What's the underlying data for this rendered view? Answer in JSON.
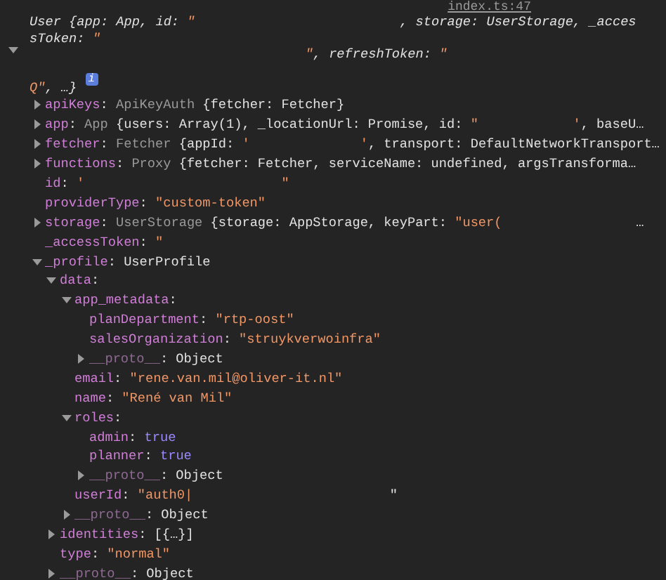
{
  "console": {
    "source_link": "index.ts:47",
    "object": {
      "expanded": true,
      "info_badge": "i",
      "summary_lines": [
        [
          {
            "kind": "text",
            "text": "User {app: App, id: "
          },
          {
            "kind": "string",
            "text": "\"                          "
          },
          {
            "kind": "text",
            "text": ", storage: UserStorage, _acces"
          }
        ],
        [
          {
            "kind": "text",
            "text": "sToken: "
          },
          {
            "kind": "string",
            "text": "\""
          }
        ],
        [
          {
            "kind": "string",
            "text": "                                   \""
          },
          {
            "kind": "text",
            "text": ", refreshToken: "
          },
          {
            "kind": "string",
            "text": "\""
          }
        ],
        [
          {
            "kind": "string",
            "text": "Q\""
          },
          {
            "kind": "text",
            "text": ", …}"
          }
        ]
      ],
      "properties": [
        {
          "expanded": false,
          "segments": [
            {
              "kind": "key",
              "text": "apiKeys"
            },
            {
              "kind": "text",
              "text": ": "
            },
            {
              "kind": "class",
              "text": "ApiKeyAuth"
            },
            {
              "kind": "text",
              "text": " {fetcher: Fetcher}"
            }
          ]
        },
        {
          "expanded": false,
          "segments": [
            {
              "kind": "key",
              "text": "app"
            },
            {
              "kind": "text",
              "text": ": "
            },
            {
              "kind": "class",
              "text": "App"
            },
            {
              "kind": "text",
              "text": " {users: Array(1), _locationUrl: Promise, id: "
            },
            {
              "kind": "string",
              "text": "\"            '"
            },
            {
              "kind": "text",
              "text": ", baseU…"
            }
          ]
        },
        {
          "expanded": false,
          "segments": [
            {
              "kind": "key",
              "text": "fetcher"
            },
            {
              "kind": "text",
              "text": ": "
            },
            {
              "kind": "class",
              "text": "Fetcher"
            },
            {
              "kind": "text",
              "text": " {appId: "
            },
            {
              "kind": "string",
              "text": "'              '"
            },
            {
              "kind": "text",
              "text": ", transport: DefaultNetworkTransport…"
            }
          ]
        },
        {
          "expanded": false,
          "segments": [
            {
              "kind": "key",
              "text": "functions"
            },
            {
              "kind": "text",
              "text": ": "
            },
            {
              "kind": "class",
              "text": "Proxy"
            },
            {
              "kind": "text",
              "text": " {fetcher: Fetcher, serviceName: undefined, argsTransforma…"
            }
          ]
        },
        {
          "segments": [
            {
              "kind": "key",
              "text": "id"
            },
            {
              "kind": "text",
              "text": ": "
            },
            {
              "kind": "string",
              "text": "'                         \""
            }
          ]
        },
        {
          "segments": [
            {
              "kind": "key",
              "text": "providerType"
            },
            {
              "kind": "text",
              "text": ": "
            },
            {
              "kind": "string",
              "text": "\"custom-token\""
            }
          ]
        },
        {
          "expanded": false,
          "segments": [
            {
              "kind": "key",
              "text": "storage"
            },
            {
              "kind": "text",
              "text": ": "
            },
            {
              "kind": "class",
              "text": "UserStorage"
            },
            {
              "kind": "text",
              "text": " {storage: AppStorage, keyPart: "
            },
            {
              "kind": "string",
              "text": "\"user("
            },
            {
              "kind": "text",
              "text": "                 …"
            }
          ]
        },
        {
          "segments": [
            {
              "kind": "key",
              "text": "_accessToken"
            },
            {
              "kind": "text",
              "text": ": "
            },
            {
              "kind": "string",
              "text": "\""
            }
          ]
        },
        {
          "expanded": true,
          "segments": [
            {
              "kind": "key",
              "text": "_profile"
            },
            {
              "kind": "text",
              "text": ": UserProfile"
            }
          ],
          "children": [
            {
              "expanded": true,
              "segments": [
                {
                  "kind": "key",
                  "text": "data"
                },
                {
                  "kind": "text",
                  "text": ":"
                }
              ],
              "children": [
                {
                  "expanded": true,
                  "segments": [
                    {
                      "kind": "key",
                      "text": "app_metadata"
                    },
                    {
                      "kind": "text",
                      "text": ":"
                    }
                  ],
                  "children": [
                    {
                      "segments": [
                        {
                          "kind": "key",
                          "text": "planDepartment"
                        },
                        {
                          "kind": "text",
                          "text": ": "
                        },
                        {
                          "kind": "string",
                          "text": "\"rtp-oost\""
                        }
                      ]
                    },
                    {
                      "segments": [
                        {
                          "kind": "key",
                          "text": "salesOrganization"
                        },
                        {
                          "kind": "text",
                          "text": ": "
                        },
                        {
                          "kind": "string",
                          "text": "\"struykverwoinfra\""
                        }
                      ]
                    },
                    {
                      "expanded": false,
                      "segments": [
                        {
                          "kind": "internal_key",
                          "text": "__proto__"
                        },
                        {
                          "kind": "text",
                          "text": ": Object"
                        }
                      ]
                    }
                  ]
                },
                {
                  "segments": [
                    {
                      "kind": "key",
                      "text": "email"
                    },
                    {
                      "kind": "text",
                      "text": ": "
                    },
                    {
                      "kind": "string",
                      "text": "\"rene.van.mil@oliver-it.nl\""
                    }
                  ]
                },
                {
                  "segments": [
                    {
                      "kind": "key",
                      "text": "name"
                    },
                    {
                      "kind": "text",
                      "text": ": "
                    },
                    {
                      "kind": "string",
                      "text": "\"René van Mil\""
                    }
                  ]
                },
                {
                  "expanded": true,
                  "segments": [
                    {
                      "kind": "key",
                      "text": "roles"
                    },
                    {
                      "kind": "text",
                      "text": ":"
                    }
                  ],
                  "children": [
                    {
                      "segments": [
                        {
                          "kind": "key",
                          "text": "admin"
                        },
                        {
                          "kind": "text",
                          "text": ": "
                        },
                        {
                          "kind": "bool",
                          "text": "true"
                        }
                      ]
                    },
                    {
                      "segments": [
                        {
                          "kind": "key",
                          "text": "planner"
                        },
                        {
                          "kind": "text",
                          "text": ": "
                        },
                        {
                          "kind": "bool",
                          "text": "true"
                        }
                      ]
                    },
                    {
                      "expanded": false,
                      "segments": [
                        {
                          "kind": "internal_key",
                          "text": "__proto__"
                        },
                        {
                          "kind": "text",
                          "text": ": Object"
                        }
                      ]
                    }
                  ]
                },
                {
                  "segments": [
                    {
                      "kind": "key",
                      "text": "userId"
                    },
                    {
                      "kind": "text",
                      "text": ": "
                    },
                    {
                      "kind": "string",
                      "text": "\"auth0|"
                    },
                    {
                      "kind": "text",
                      "text": "                         \""
                    }
                  ]
                },
                {
                  "expanded": false,
                  "segments": [
                    {
                      "kind": "internal_key",
                      "text": "__proto__"
                    },
                    {
                      "kind": "text",
                      "text": ": Object"
                    }
                  ]
                }
              ]
            },
            {
              "expanded": false,
              "segments": [
                {
                  "kind": "key",
                  "text": "identities"
                },
                {
                  "kind": "text",
                  "text": ": [{…}]"
                }
              ]
            },
            {
              "segments": [
                {
                  "kind": "key",
                  "text": "type"
                },
                {
                  "kind": "text",
                  "text": ": "
                },
                {
                  "kind": "string",
                  "text": "\"normal\""
                }
              ]
            },
            {
              "expanded": false,
              "segments": [
                {
                  "kind": "internal_key",
                  "text": "__proto__"
                },
                {
                  "kind": "text",
                  "text": ": Object"
                }
              ]
            }
          ]
        }
      ]
    }
  }
}
